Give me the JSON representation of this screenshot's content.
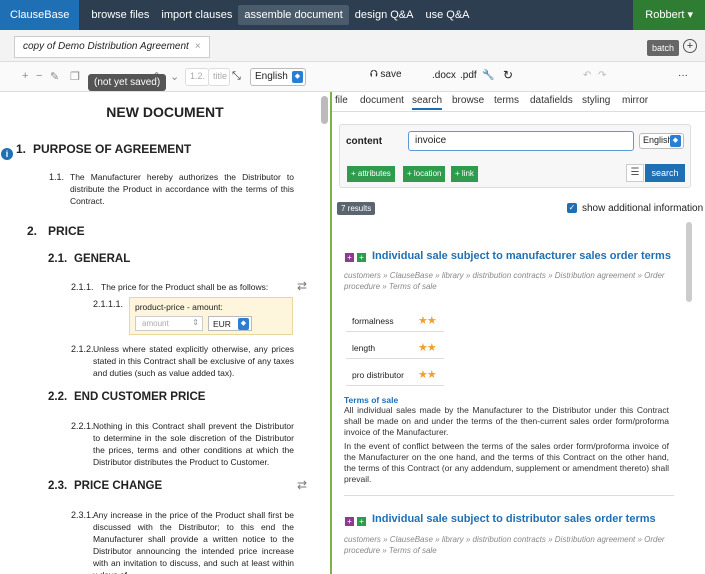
{
  "nav": {
    "brand": "ClauseBase",
    "links": [
      "browse files",
      "import clauses",
      "assemble document",
      "design Q&A",
      "use Q&A"
    ],
    "active": "assemble document",
    "user": "Robbert ▾"
  },
  "tabs": {
    "doc_tab": "copy of Demo Distribution Agreement",
    "close": "×",
    "batch": "batch"
  },
  "toolbar": {
    "tooltip": "(not yet saved)",
    "num_placeholder": "1.2.",
    "title_placeholder": "title",
    "language": "English",
    "save": "save",
    "docx": ".docx",
    "pdf": ".pdf",
    "more": "···"
  },
  "document": {
    "title": "NEW DOCUMENT",
    "s1_num": "1.",
    "s1_title": "PURPOSE OF AGREEMENT",
    "s1_1_num": "1.1.",
    "s1_1_text": "The Manufacturer hereby authorizes the Distributor to distribute the Product in accordance with the terms of this Contract.",
    "s2_num": "2.",
    "s2_title": "PRICE",
    "s2_1_num": "2.1.",
    "s2_1_title": "GENERAL",
    "s2_1_1_num": "2.1.1.",
    "s2_1_1_text": "The price for the Product shall be as follows:",
    "s2_1_1_1_num": "2.1.1.1.",
    "field_label": "product-price - amount:",
    "amount_placeholder": "amount",
    "currency": "EUR",
    "s2_1_2_num": "2.1.2.",
    "s2_1_2_text": "Unless where stated explicitly otherwise, any prices stated in this Contract shall be exclusive of any taxes and duties (such as value added tax).",
    "s2_2_num": "2.2.",
    "s2_2_title": "END CUSTOMER PRICE",
    "s2_2_1_num": "2.2.1.",
    "s2_2_1_text": "Nothing in this Contract shall prevent the Distributor to determine in the sole discretion of the Distributor the prices, terms and other conditions at which the Distributor distributes the Product to Customer.",
    "s2_3_num": "2.3.",
    "s2_3_title": "PRICE CHANGE",
    "s2_3_1_num": "2.3.1.",
    "s2_3_1_text": "Any increase in the price of the Product shall first be discussed with the Distributor; to this end the Manufacturer shall provide a written notice to the Distributor announcing the intended price increase with an invitation to discuss, and such at least within x days of"
  },
  "right": {
    "tabs": [
      "file",
      "document",
      "search",
      "browse",
      "terms",
      "datafields",
      "styling",
      "mirror"
    ],
    "active_tab": "search",
    "content_label": "content",
    "query": "invoice",
    "lang": "English",
    "btn_attributes": "+ attributes",
    "btn_location": "+ location",
    "btn_link": "+ link",
    "search_btn": "search",
    "results": "7 results",
    "show_info": "show additional information",
    "r1_title": "Individual sale subject to manufacturer sales order terms",
    "r1_crumbs": "customers » ClauseBase » library » distribution contracts » Distribution agreement » Order procedure » Terms of sale",
    "props": [
      {
        "k": "formalness",
        "stars": "★★"
      },
      {
        "k": "length",
        "stars": "★★"
      },
      {
        "k": "pro distributor",
        "stars": "★★"
      }
    ],
    "tos_title": "Terms of sale",
    "p1": "All individual sales made by the Manufacturer to the Distributor under this Contract shall be made on and under the terms of the then-current sales order form/proforma invoice of the Manufacturer.",
    "p2": "In the event of conflict between the terms of the sales order form/proforma invoice of the Manufacturer on the one hand, and the terms of this Contract on the other hand, the terms of this Contract (or any addendum, supplement or amendment thereto) shall prevail.",
    "r2_title": "Individual sale subject to distributor sales order terms",
    "r2_crumbs": "customers » ClauseBase » library » distribution contracts » Distribution agreement » Order procedure » Terms of sale"
  },
  "colors": {
    "nav_bg": "#2c3e50",
    "brand_bg": "#1f6fb5",
    "user_bg": "#2f7d32",
    "accent_green": "#2e9c4c",
    "link_blue": "#1f6fb5"
  }
}
